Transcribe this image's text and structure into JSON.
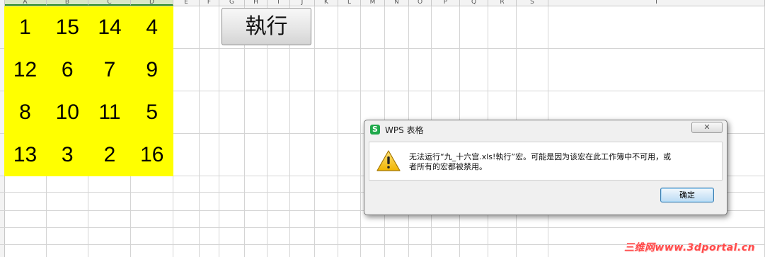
{
  "sheet": {
    "columns": [
      "A",
      "B",
      "C",
      "D",
      "E",
      "F",
      "G",
      "H",
      "I",
      "J",
      "K",
      "L",
      "M",
      "N",
      "O",
      "P",
      "Q",
      "R",
      "S",
      "T",
      "U"
    ],
    "selected_columns": [
      "A",
      "B",
      "C",
      "D"
    ],
    "magic_square": [
      [
        1,
        15,
        14,
        4
      ],
      [
        12,
        6,
        7,
        9
      ],
      [
        8,
        10,
        11,
        5
      ],
      [
        13,
        3,
        2,
        16
      ]
    ],
    "fill_color": "#ffff00"
  },
  "run_button": {
    "label": "執行"
  },
  "dialog": {
    "title": "WPS 表格",
    "logo_letter": "S",
    "close_glyph": "✕",
    "message_line1": "无法运行“九_十六宫.xls!執行”宏。可能是因为该宏在此工作簿中不可用，或",
    "message_line2": "者所有的宏都被禁用。",
    "ok_label": "确定",
    "icon": "warning-icon"
  },
  "watermark": "三维网www.3dportal.cn"
}
